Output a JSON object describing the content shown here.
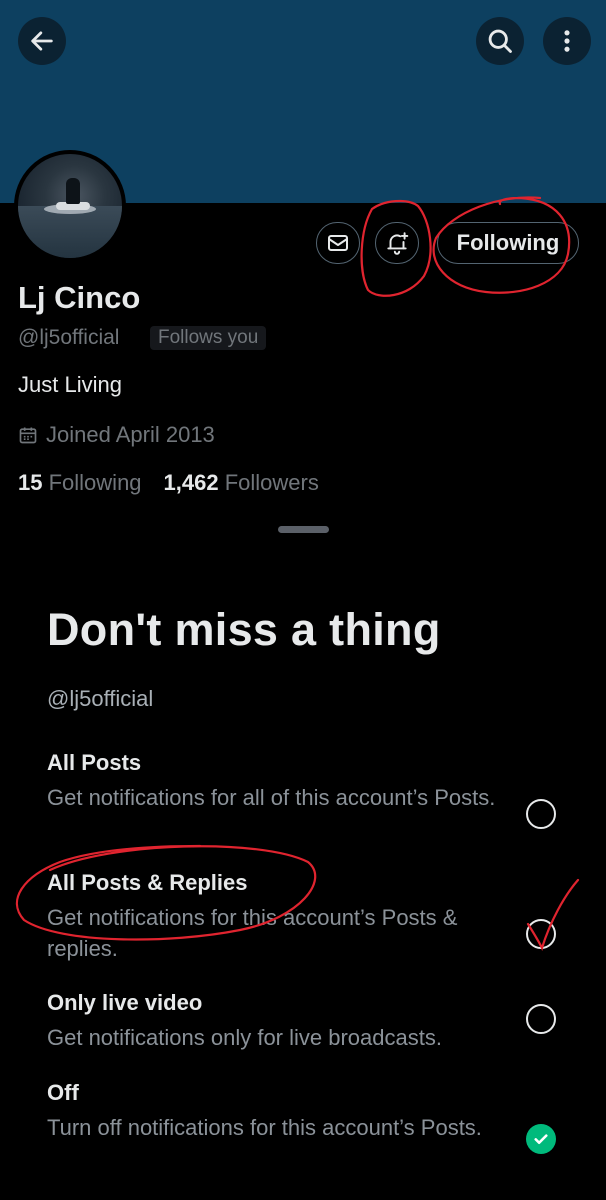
{
  "colors": {
    "banner": "#0d4060",
    "background": "#000000",
    "accent_green": "#00ba7c",
    "annotation_red": "#e0242f"
  },
  "header": {
    "back_icon": "arrow-left-icon",
    "search_icon": "search-icon",
    "more_icon": "more-vertical-icon"
  },
  "profile": {
    "name": "Lj Cinco",
    "handle": "@lj5official",
    "follows_you": "Follows you",
    "bio": "Just Living",
    "joined": "Joined April 2013",
    "following_count": "15",
    "following_label": "Following",
    "followers_count": "1,462",
    "followers_label": "Followers",
    "following_button": "Following"
  },
  "sheet": {
    "title": "Don't miss a thing",
    "handle": "@lj5official",
    "options": [
      {
        "label": "All Posts",
        "desc": "Get notifications for all of this account’s Posts.",
        "checked": false
      },
      {
        "label": "All Posts & Replies",
        "desc": "Get notifications for this account’s Posts & replies.",
        "checked": false
      },
      {
        "label": "Only live video",
        "desc": "Get notifications only for live broadcasts.",
        "checked": false
      },
      {
        "label": "Off",
        "desc": "Turn off notifications for this account’s Posts.",
        "checked": true
      }
    ]
  }
}
